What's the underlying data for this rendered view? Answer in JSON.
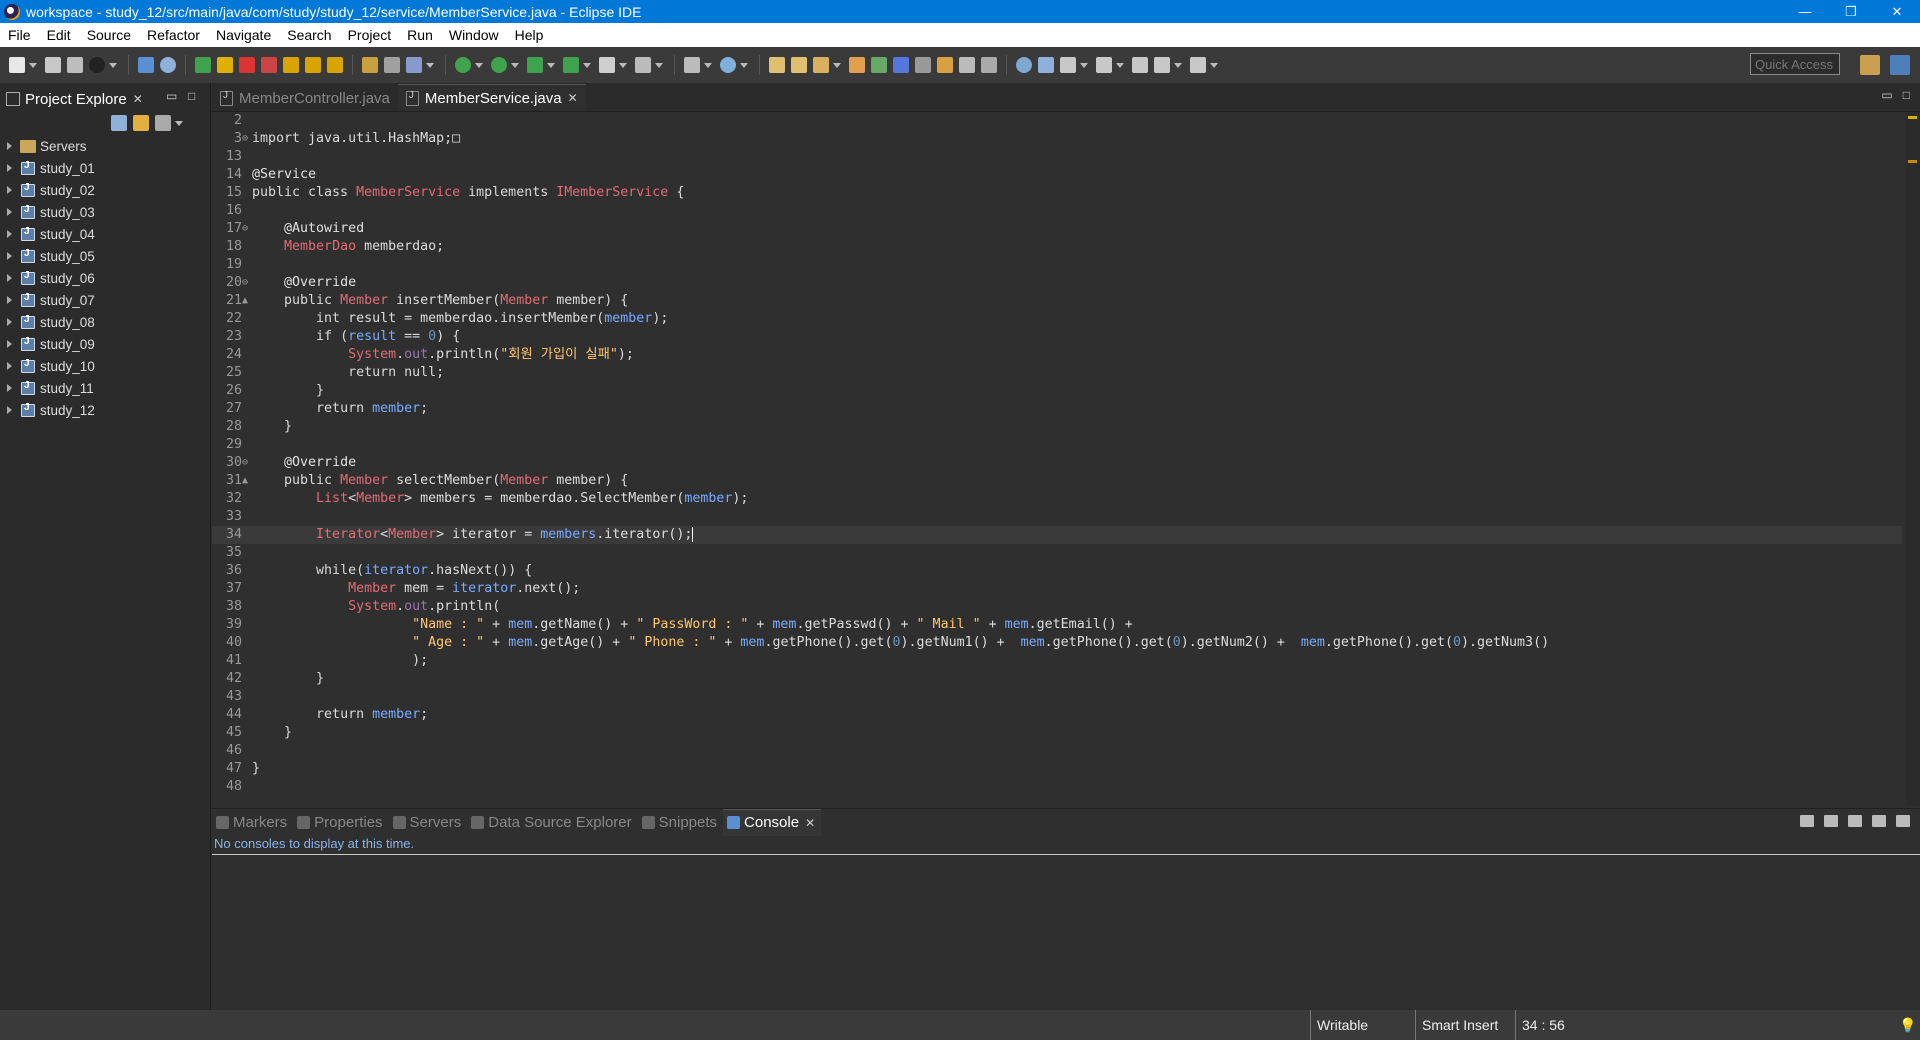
{
  "window": {
    "title": "workspace - study_12/src/main/java/com/study/study_12/service/MemberService.java - Eclipse IDE",
    "minimize": "—",
    "restore": "❐",
    "close": "✕"
  },
  "menu": [
    "File",
    "Edit",
    "Source",
    "Refactor",
    "Navigate",
    "Search",
    "Project",
    "Run",
    "Window",
    "Help"
  ],
  "toolbar": {
    "quick_access_placeholder": "Quick Access"
  },
  "explorer": {
    "title": "Project Explore",
    "items": [
      "Servers",
      "study_01",
      "study_02",
      "study_03",
      "study_04",
      "study_05",
      "study_06",
      "study_07",
      "study_08",
      "study_09",
      "study_10",
      "study_11",
      "study_12"
    ]
  },
  "editor": {
    "tabs": [
      {
        "label": "MemberController.java",
        "active": false
      },
      {
        "label": "MemberService.java",
        "active": true
      }
    ],
    "lines": [
      {
        "no": "2",
        "marker": "",
        "tokens": []
      },
      {
        "no": "3",
        "marker": "⊖",
        "tokens": [
          [
            "kwb",
            "import "
          ],
          [
            "",
            "java.util.HashMap;"
          ],
          [
            "",
            "□"
          ]
        ]
      },
      {
        "no": "13",
        "marker": "",
        "tokens": []
      },
      {
        "no": "14",
        "marker": "",
        "tokens": [
          [
            "ann",
            "@Service"
          ]
        ]
      },
      {
        "no": "15",
        "marker": "",
        "tokens": [
          [
            "kwb",
            "public class "
          ],
          [
            "type",
            "MemberService "
          ],
          [
            "kwb",
            "implements "
          ],
          [
            "iface",
            "IMemberService "
          ],
          [
            "",
            "{"
          ]
        ]
      },
      {
        "no": "16",
        "marker": "",
        "tokens": []
      },
      {
        "no": "17",
        "marker": "⊖",
        "tokens": [
          [
            "",
            "    "
          ],
          [
            "ann",
            "@Autowired"
          ]
        ]
      },
      {
        "no": "18",
        "marker": "",
        "tokens": [
          [
            "",
            "    "
          ],
          [
            "type",
            "MemberDao "
          ],
          [
            "",
            "memberdao;"
          ]
        ]
      },
      {
        "no": "19",
        "marker": "",
        "tokens": []
      },
      {
        "no": "20",
        "marker": "⊖",
        "tokens": [
          [
            "",
            "    "
          ],
          [
            "ann",
            "@Override"
          ]
        ]
      },
      {
        "no": "21",
        "marker": "▲",
        "tokens": [
          [
            "",
            "    "
          ],
          [
            "kwb",
            "public "
          ],
          [
            "type",
            "Member "
          ],
          [
            "",
            "insertMember("
          ],
          [
            "type",
            "Member "
          ],
          [
            "",
            "member) {"
          ]
        ]
      },
      {
        "no": "22",
        "marker": "",
        "tokens": [
          [
            "",
            "        "
          ],
          [
            "kwb",
            "int "
          ],
          [
            "",
            "result = memberdao.insertMember("
          ],
          [
            "var",
            "member"
          ],
          [
            "",
            ");"
          ]
        ]
      },
      {
        "no": "23",
        "marker": "",
        "tokens": [
          [
            "",
            "        "
          ],
          [
            "kwb",
            "if "
          ],
          [
            "",
            "("
          ],
          [
            "var",
            "result"
          ],
          [
            "",
            " == "
          ],
          [
            "num",
            "0"
          ],
          [
            "",
            ") {"
          ]
        ]
      },
      {
        "no": "24",
        "marker": "",
        "tokens": [
          [
            "",
            "            "
          ],
          [
            "type",
            "System"
          ],
          [
            "",
            "."
          ],
          [
            "fld",
            "out"
          ],
          [
            "",
            ".println("
          ],
          [
            "str",
            "\"회원 가입이 실패\""
          ],
          [
            "",
            ");"
          ]
        ]
      },
      {
        "no": "25",
        "marker": "",
        "tokens": [
          [
            "",
            "            "
          ],
          [
            "kwb",
            "return null"
          ],
          [
            "",
            ";"
          ]
        ]
      },
      {
        "no": "26",
        "marker": "",
        "tokens": [
          [
            "",
            "        }"
          ]
        ]
      },
      {
        "no": "27",
        "marker": "",
        "tokens": [
          [
            "",
            "        "
          ],
          [
            "kwb",
            "return "
          ],
          [
            "var",
            "member"
          ],
          [
            "",
            ";"
          ]
        ]
      },
      {
        "no": "28",
        "marker": "",
        "tokens": [
          [
            "",
            "    }"
          ]
        ]
      },
      {
        "no": "29",
        "marker": "",
        "tokens": []
      },
      {
        "no": "30",
        "marker": "⊖",
        "tokens": [
          [
            "",
            "    "
          ],
          [
            "ann",
            "@Override"
          ]
        ]
      },
      {
        "no": "31",
        "marker": "▲",
        "tokens": [
          [
            "",
            "    "
          ],
          [
            "kwb",
            "public "
          ],
          [
            "type",
            "Member "
          ],
          [
            "",
            "selectMember("
          ],
          [
            "type",
            "Member "
          ],
          [
            "",
            "member) {"
          ]
        ]
      },
      {
        "no": "32",
        "marker": "",
        "tokens": [
          [
            "",
            "        "
          ],
          [
            "type",
            "List"
          ],
          [
            "",
            "<"
          ],
          [
            "type",
            "Member"
          ],
          [
            "",
            "> members = memberdao.SelectMember("
          ],
          [
            "var",
            "member"
          ],
          [
            "",
            ");"
          ]
        ]
      },
      {
        "no": "33",
        "marker": "",
        "tokens": []
      },
      {
        "no": "34",
        "marker": "",
        "current": true,
        "tokens": [
          [
            "",
            "        "
          ],
          [
            "type",
            "Iterator"
          ],
          [
            "",
            "<"
          ],
          [
            "type",
            "Member"
          ],
          [
            "",
            "> iterator = "
          ],
          [
            "var",
            "members"
          ],
          [
            "",
            ".iterator();"
          ]
        ]
      },
      {
        "no": "35",
        "marker": "",
        "tokens": []
      },
      {
        "no": "36",
        "marker": "",
        "tokens": [
          [
            "",
            "        "
          ],
          [
            "kwb",
            "while"
          ],
          [
            "",
            "("
          ],
          [
            "var",
            "iterator"
          ],
          [
            "",
            ".hasNext()) {"
          ]
        ]
      },
      {
        "no": "37",
        "marker": "",
        "tokens": [
          [
            "",
            "            "
          ],
          [
            "type",
            "Member "
          ],
          [
            "",
            "mem = "
          ],
          [
            "var",
            "iterator"
          ],
          [
            "",
            ".next();"
          ]
        ]
      },
      {
        "no": "38",
        "marker": "",
        "tokens": [
          [
            "",
            "            "
          ],
          [
            "type",
            "System"
          ],
          [
            "",
            "."
          ],
          [
            "fld",
            "out"
          ],
          [
            "",
            ".println("
          ]
        ]
      },
      {
        "no": "39",
        "marker": "",
        "tokens": [
          [
            "",
            "                    "
          ],
          [
            "str",
            "\"Name : \""
          ],
          [
            "",
            " + "
          ],
          [
            "var",
            "mem"
          ],
          [
            "",
            ".getName() + "
          ],
          [
            "str",
            "\" PassWord : \""
          ],
          [
            "",
            " + "
          ],
          [
            "var",
            "mem"
          ],
          [
            "",
            ".getPasswd() + "
          ],
          [
            "str",
            "\" Mail \""
          ],
          [
            "",
            " + "
          ],
          [
            "var",
            "mem"
          ],
          [
            "",
            ".getEmail() +"
          ]
        ]
      },
      {
        "no": "40",
        "marker": "",
        "tokens": [
          [
            "",
            "                    "
          ],
          [
            "str",
            "\" Age : \""
          ],
          [
            "",
            " + "
          ],
          [
            "var",
            "mem"
          ],
          [
            "",
            ".getAge() + "
          ],
          [
            "str",
            "\" Phone : \""
          ],
          [
            "",
            " + "
          ],
          [
            "var",
            "mem"
          ],
          [
            "",
            ".getPhone().get("
          ],
          [
            "num",
            "0"
          ],
          [
            "",
            ").getNum1() +  "
          ],
          [
            "var",
            "mem"
          ],
          [
            "",
            ".getPhone().get("
          ],
          [
            "num",
            "0"
          ],
          [
            "",
            ").getNum2() +  "
          ],
          [
            "var",
            "mem"
          ],
          [
            "",
            ".getPhone().get("
          ],
          [
            "num",
            "0"
          ],
          [
            "",
            ").getNum3()"
          ]
        ]
      },
      {
        "no": "41",
        "marker": "",
        "tokens": [
          [
            "",
            "                    );"
          ]
        ]
      },
      {
        "no": "42",
        "marker": "",
        "tokens": [
          [
            "",
            "        }"
          ]
        ]
      },
      {
        "no": "43",
        "marker": "",
        "tokens": []
      },
      {
        "no": "44",
        "marker": "",
        "tokens": [
          [
            "",
            "        "
          ],
          [
            "kwb",
            "return "
          ],
          [
            "var",
            "member"
          ],
          [
            "",
            ";"
          ]
        ]
      },
      {
        "no": "45",
        "marker": "",
        "tokens": [
          [
            "",
            "    }"
          ]
        ]
      },
      {
        "no": "46",
        "marker": "",
        "tokens": []
      },
      {
        "no": "47",
        "marker": "",
        "tokens": [
          [
            "",
            "}"
          ]
        ]
      },
      {
        "no": "48",
        "marker": "",
        "tokens": []
      }
    ]
  },
  "bottom": {
    "tabs": [
      {
        "label": "Markers",
        "active": false
      },
      {
        "label": "Properties",
        "active": false
      },
      {
        "label": "Servers",
        "active": false
      },
      {
        "label": "Data Source Explorer",
        "active": false
      },
      {
        "label": "Snippets",
        "active": false
      },
      {
        "label": "Console",
        "active": true
      }
    ],
    "console_message": "No consoles to display at this time."
  },
  "status": {
    "writable": "Writable",
    "insert_mode": "Smart Insert",
    "position": "34 : 56"
  },
  "colors": {
    "title_bar": "#0078d7",
    "editor_bg": "#2f2f2f",
    "string": "#ffc66d",
    "type": "#e06c75",
    "variable": "#79abff"
  }
}
